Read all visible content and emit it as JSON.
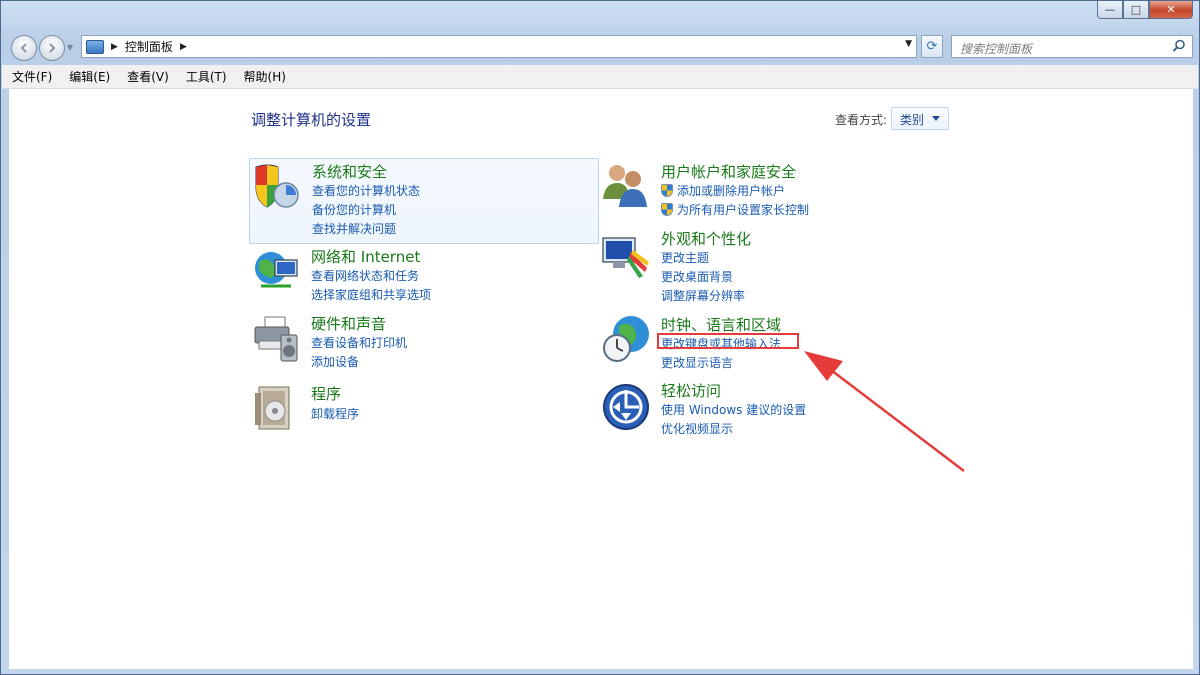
{
  "window": {
    "caption": {
      "minimize": "—",
      "maximize": "□",
      "close": "✕"
    }
  },
  "nav": {
    "back_icon": "back-arrow-icon",
    "forward_icon": "forward-arrow-icon",
    "address_path": "控制面板",
    "search_placeholder": "搜索控制面板",
    "refresh_glyph": "⟳"
  },
  "menu": {
    "items": [
      "文件(F)",
      "编辑(E)",
      "查看(V)",
      "工具(T)",
      "帮助(H)"
    ]
  },
  "main": {
    "title": "调整计算机的设置",
    "view_by_label": "查看方式:",
    "view_by_value": "类别"
  },
  "categories": [
    {
      "title": "系统和安全",
      "icon": "shield-computer-icon",
      "links": [
        "查看您的计算机状态",
        "备份您的计算机",
        "查找并解决问题"
      ]
    },
    {
      "title": "网络和 Internet",
      "icon": "network-globe-icon",
      "links": [
        "查看网络状态和任务",
        "选择家庭组和共享选项"
      ]
    },
    {
      "title": "硬件和声音",
      "icon": "printer-speaker-icon",
      "links": [
        "查看设备和打印机",
        "添加设备"
      ]
    },
    {
      "title": "程序",
      "icon": "programs-box-icon",
      "links": [
        "卸载程序"
      ]
    },
    {
      "title": "用户帐户和家庭安全",
      "icon": "users-icon",
      "links": [
        "添加或删除用户帐户",
        "为所有用户设置家长控制"
      ]
    },
    {
      "title": "外观和个性化",
      "icon": "monitor-paint-icon",
      "links": [
        "更改主题",
        "更改桌面背景",
        "调整屏幕分辨率"
      ]
    },
    {
      "title": "时钟、语言和区域",
      "icon": "globe-clock-icon",
      "links": [
        "更改键盘或其他输入法",
        "更改显示语言"
      ]
    },
    {
      "title": "轻松访问",
      "icon": "ease-of-access-icon",
      "links": [
        "使用 Windows 建议的设置",
        "优化视频显示"
      ]
    }
  ],
  "colors": {
    "category_title": "#1a7a1a",
    "link": "#1a5bb0",
    "annotation": "#e53b3b"
  }
}
